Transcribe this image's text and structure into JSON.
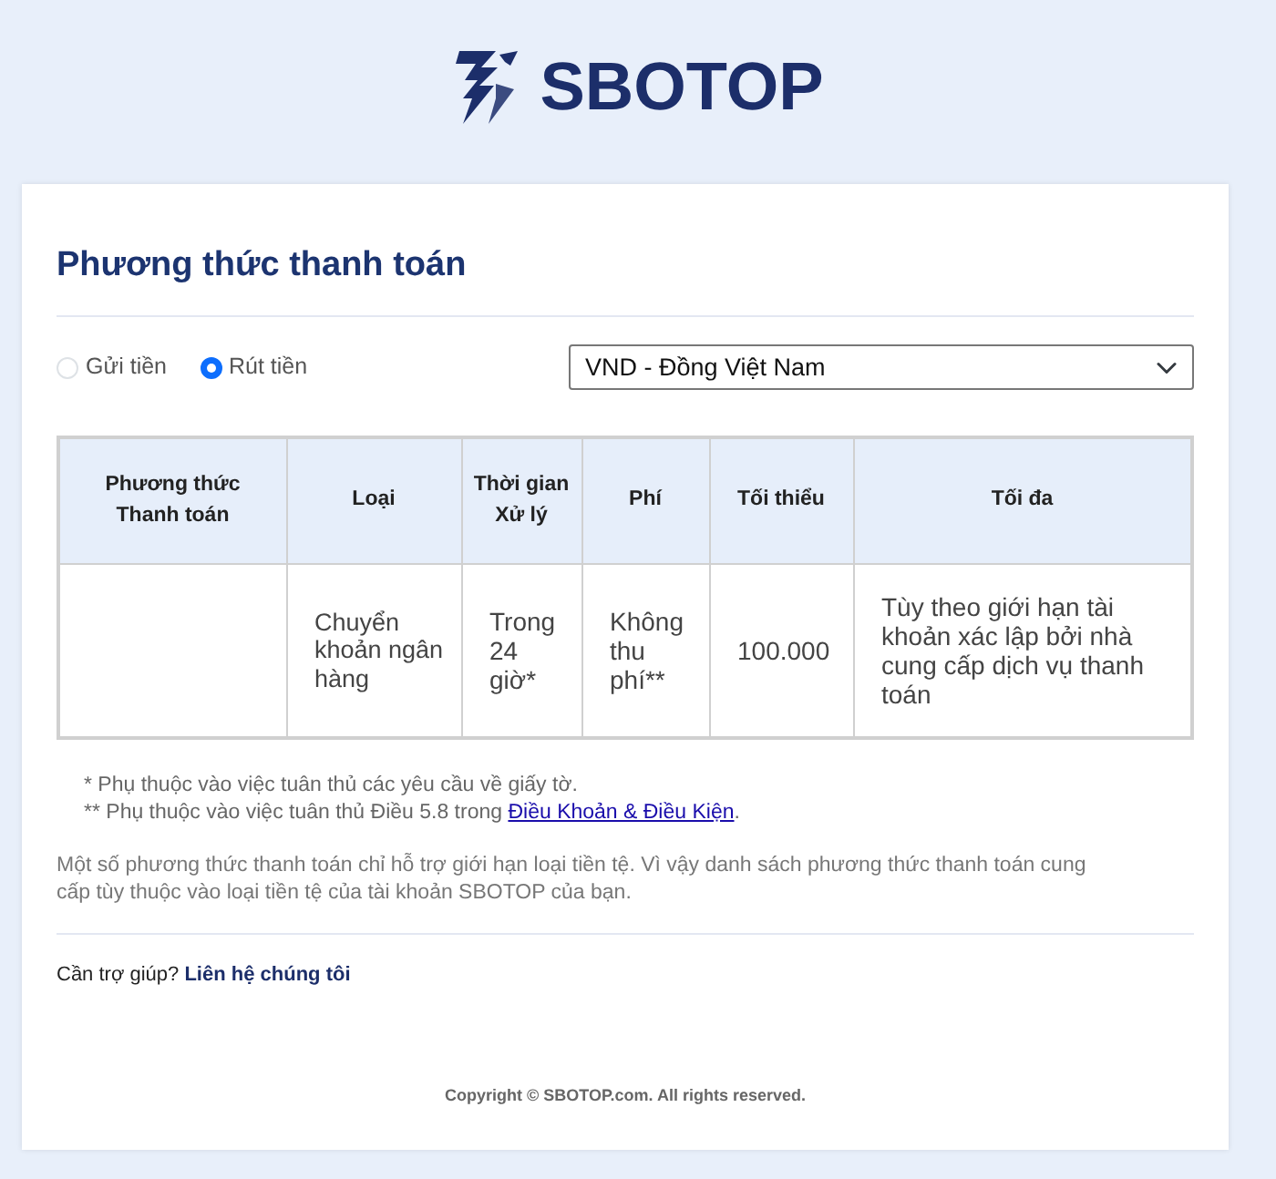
{
  "logo": {
    "text": "SBOTOP"
  },
  "title": "Phương thức thanh toán",
  "transaction_types": [
    {
      "label": "Gửi tiền",
      "selected": false
    },
    {
      "label": "Rút tiền",
      "selected": true
    }
  ],
  "currency_select": {
    "value": "VND - Đồng Việt Nam"
  },
  "table": {
    "columns": [
      "Phương thức Thanh toán",
      "Loại",
      "Thời gian Xử lý",
      "Phí",
      "Tối thiểu",
      "Tối đa"
    ],
    "rows": [
      [
        "",
        "Chuyển khoản ngân hàng",
        "Trong 24 giờ*",
        "Không thu phí**",
        "100.000",
        "Tùy theo giới hạn tài khoản xác lập bởi nhà cung cấp dịch vụ thanh toán"
      ]
    ]
  },
  "notes": [
    {
      "text": "* Phụ thuộc vào việc tuân thủ các yêu cầu về giấy tờ."
    },
    {
      "text": "** Phụ thuộc vào việc tuân thủ Điều 5.8 trong ",
      "link": "Điều Khoản & Điều Kiện",
      "suffix": "."
    }
  ],
  "info": "Một số phương thức thanh toán chỉ hỗ trợ giới hạn loại tiền tệ. Vì vậy danh sách phương thức thanh toán cung cấp tùy thuộc vào loại tiền tệ của tài khoản SBOTOP của bạn.",
  "help": {
    "text": "Cần trợ giúp? ",
    "link": "Liên hệ chúng tôi"
  },
  "copyright": "Copyright © SBOTOP.com. All rights reserved."
}
